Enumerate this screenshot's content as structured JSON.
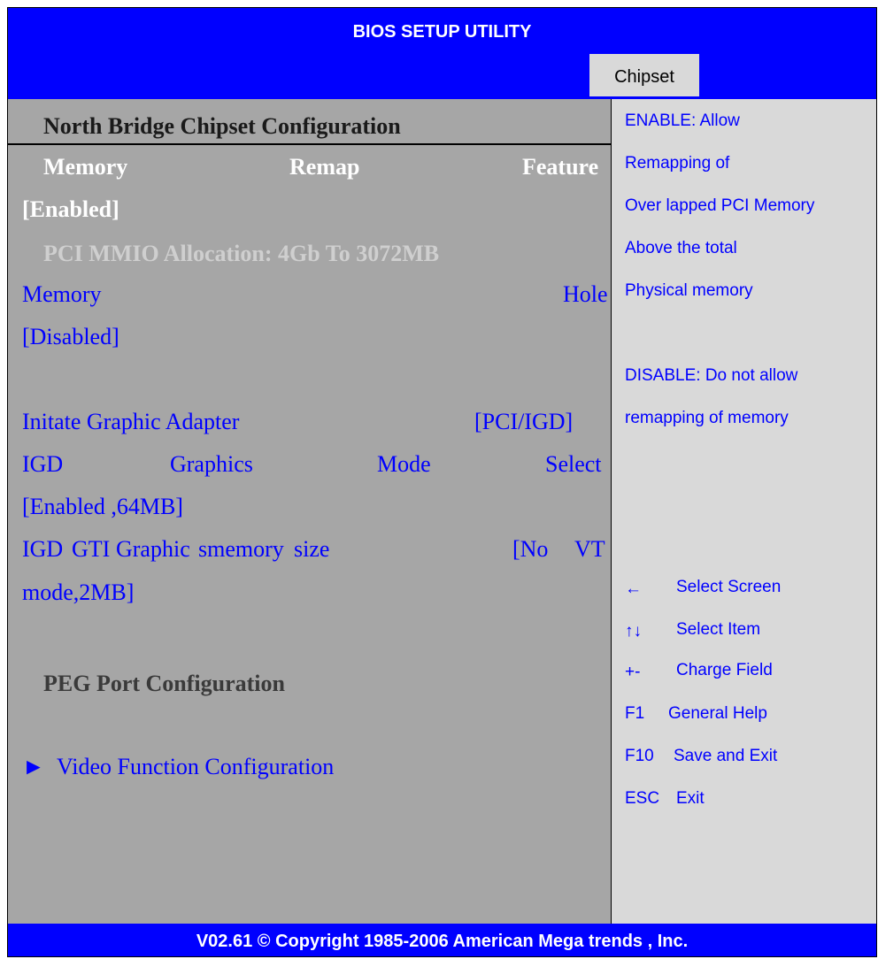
{
  "window": {
    "title": "BIOS SETUP UTILITY"
  },
  "tabs": [
    {
      "label": "Chipset"
    }
  ],
  "main": {
    "section_title": "North Bridge Chipset Configuration",
    "items": [
      {
        "words": [
          "Memory",
          "Remap",
          "Feature"
        ],
        "value": "[Enabled]"
      },
      {
        "label": "PCI MMIO Allocation: 4Gb To 3072MB"
      },
      {
        "words": [
          "Memory",
          "Hole"
        ],
        "value": "[Disabled]"
      },
      {
        "label": "Initate Graphic Adapter",
        "value": "[PCI/IGD]"
      },
      {
        "words": [
          "IGD",
          "Graphics",
          "Mode",
          "Select"
        ],
        "value": "[Enabled ,64MB]"
      },
      {
        "words": [
          "IGD",
          "GTI",
          "Graphic",
          "smemory",
          "size",
          "[No",
          "VT"
        ],
        "value": "mode,2MB]"
      }
    ],
    "peg_title": "PEG Port Configuration",
    "submenu": {
      "arrow": "►",
      "label": "Video Function Configuration"
    }
  },
  "help": {
    "lines": [
      "ENABLE: Allow",
      "Remapping of",
      "Over lapped PCI Memory",
      "Above the total",
      "Physical memory",
      "DISABLE: Do not allow",
      "remapping of memory"
    ]
  },
  "keys": [
    {
      "key": "←",
      "desc": "Select Screen"
    },
    {
      "key": "↑↓",
      "desc": "Select Item"
    },
    {
      "key": "+-",
      "desc": "Charge Field"
    },
    {
      "key": "F1",
      "desc": "General Help"
    },
    {
      "key": "F10",
      "desc": "Save and Exit"
    },
    {
      "key": "ESC",
      "desc": "Exit"
    }
  ],
  "footer": {
    "text": "V02.61 © Copyright 1985-2006 American Mega trends , Inc."
  },
  "colors": {
    "bar": "#0000ff",
    "panel_left": "#a6a6a6",
    "panel_right": "#d9d9d9",
    "text_blue": "#0000ff"
  }
}
